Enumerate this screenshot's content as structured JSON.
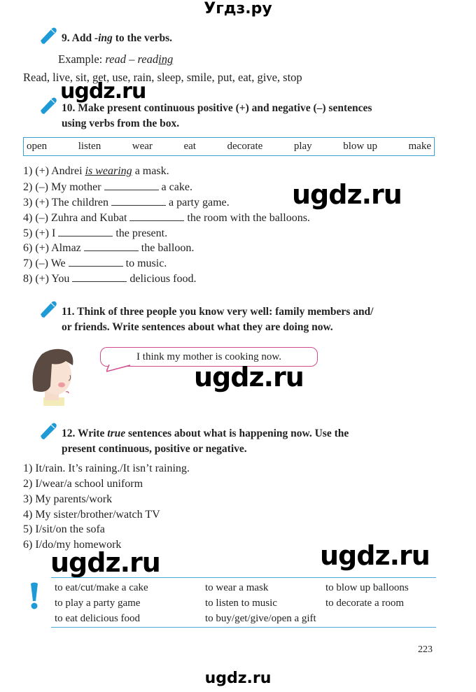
{
  "header": {
    "site_title": "Угдз.ру"
  },
  "watermarks": [
    "ugdz.ru",
    "ugdz.ru",
    "ugdz.ru",
    "ugdz.ru",
    "ugdz.ru"
  ],
  "footer": {
    "site_title": "ugdz.ru"
  },
  "page_number": "223",
  "accent_color": "#3aa0d8",
  "ex9": {
    "number": "9.",
    "title_pre": "Add",
    "title_em": "-ing",
    "title_post": "to the verbs.",
    "example_label": "Example:",
    "example_word": "read",
    "example_dash": "–",
    "example_stem": "read",
    "example_suffix": "ing",
    "verbs": "Read, live, sit, get, use, rain, sleep, smile, put, eat, give, stop"
  },
  "ex10": {
    "title_line1": "10. Make present continuous positive (+) and negative (–) sentences",
    "title_line2": "using verbs from the box.",
    "box_words": [
      "open",
      "listen",
      "wear",
      "eat",
      "decorate",
      "play",
      "blow up",
      "make"
    ],
    "sentences": [
      {
        "pre": "1) (+) Andrei",
        "answer": "is wearing",
        "post": "a mask."
      },
      {
        "pre": "2) (–) My mother",
        "post": "a cake."
      },
      {
        "pre": "3) (+) The children",
        "post": "a party game."
      },
      {
        "pre": "4) (–) Zuhra and Kubat",
        "post": "the room with the balloons."
      },
      {
        "pre": "5) (+) I",
        "post": "the present."
      },
      {
        "pre": "6) (+) Almaz",
        "post": "the balloon."
      },
      {
        "pre": "7) (–) We",
        "post": "to music."
      },
      {
        "pre": "8) (+) You",
        "post": "delicious food."
      }
    ]
  },
  "ex11": {
    "title_line1": "11. Think of three people you know very well: family members and/",
    "title_line2": "or friends. Write sentences about what they are doing now.",
    "speech": "I think my mother is cooking now."
  },
  "ex12": {
    "title_pre": "12. Write",
    "title_em": "true",
    "title_post": "sentences about what is happening now. Use the",
    "title_line2": "present continuous, positive or negative.",
    "items": [
      "1) It/rain. It’s raining./It isn’t raining.",
      "2) I/wear/a school uniform",
      "3) My parents/work",
      "4) My sister/brother/watch TV",
      "5) I/sit/on the sofa",
      "6) I/do/my homework"
    ]
  },
  "info_box": {
    "icon": "exclamation-icon",
    "col1": [
      "to eat/cut/make a cake",
      "to play a party game",
      "to eat delicious food"
    ],
    "col2": [
      "to wear a mask",
      "to listen to music",
      "to buy/get/give/open a gift"
    ],
    "col3": [
      "to blow up balloons",
      "to decorate a room"
    ]
  }
}
